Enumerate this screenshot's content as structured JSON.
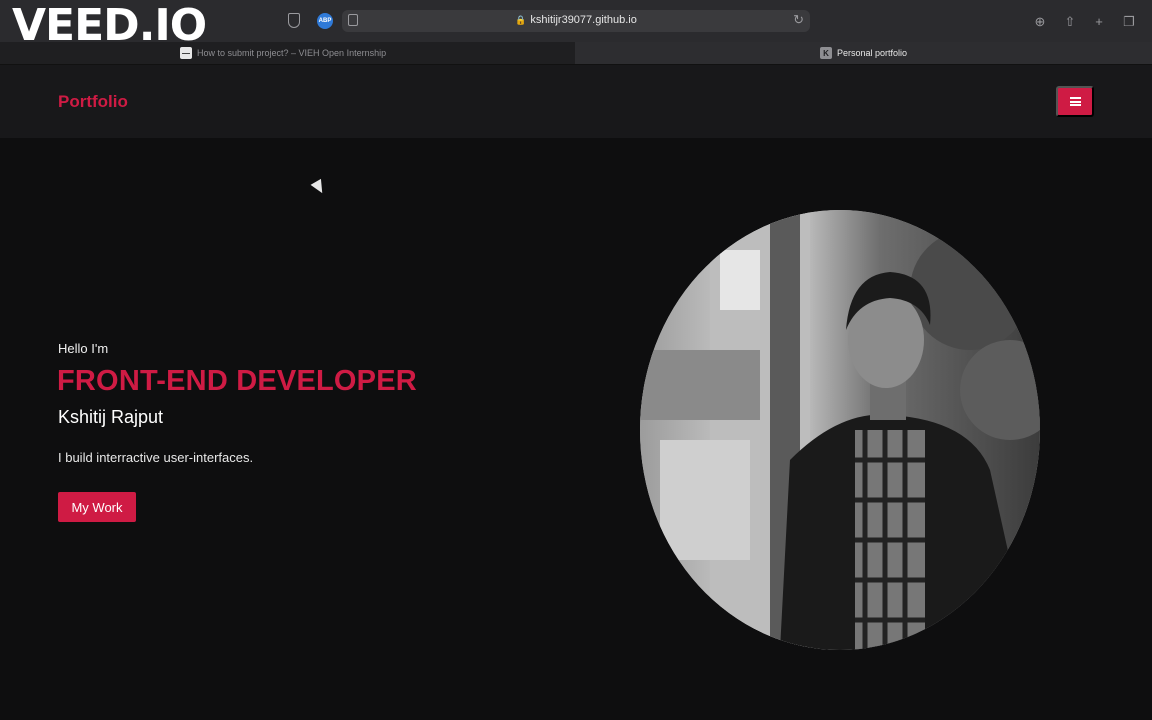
{
  "watermark": "VEED.IO",
  "browser": {
    "url": "kshitijr39077.github.io",
    "extension_badge": "ABP",
    "tabs": [
      {
        "title": "How to submit project? – VIEH Open Internship",
        "active": false
      },
      {
        "title": "Personal portfolio",
        "favicon_letter": "K",
        "active": true
      }
    ],
    "toolbar_icons": [
      "shield-icon",
      "reader-icon",
      "reload-icon",
      "download-icon",
      "share-icon",
      "new-tab-icon",
      "tab-overview-icon"
    ]
  },
  "navbar": {
    "brand": "Portfolio",
    "menu_icon": "hamburger-icon"
  },
  "hero": {
    "greeting": "Hello I'm",
    "role": "FRONT-END DEVELOPER",
    "name": "Kshitij Rajput",
    "tagline": "I build interractive user-interfaces.",
    "cta_label": "My Work"
  },
  "colors": {
    "accent": "#cf1b44",
    "page_bg": "#0e0e0f",
    "navbar_bg": "#18181a"
  }
}
